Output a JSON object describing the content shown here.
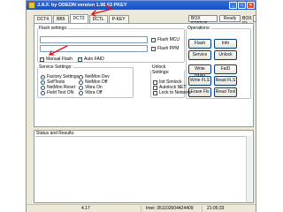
{
  "window": {
    "title": "J.A.F. by ODEON version 1.98.63 PKEY"
  },
  "tabs": [
    "DCT4",
    "BB5",
    "DCT3",
    "DCTL",
    "P-KEY"
  ],
  "header": {
    "box_status": "BOX STATUS",
    "ready": "Ready",
    "box_id_label": "BOX ID:"
  },
  "flash_settings": {
    "legend": "Flash settings:",
    "flash_mcu": "Flash MCU",
    "flash_ppm": "Flash PPM",
    "manual_flash": "Manual Flash",
    "auto_faid": "Auto FAID"
  },
  "operations": {
    "legend": "Operations:",
    "buttons": [
      "Flash",
      "Info",
      "Service",
      "Unlock",
      "Write PMM",
      "FaID",
      "Write FLS",
      "Read FLS",
      "Erase Fls",
      "Read Tool"
    ]
  },
  "service_settings": {
    "legend": "Service Settings:",
    "options": [
      "Factory Settings",
      "SelfTests",
      "NetMon Reset",
      "Field Test ON",
      "NetMon Dev",
      "NetMon Off",
      "Vibra On",
      "Vibra Off"
    ]
  },
  "unlock_settings": {
    "legend": "Unlock Settings:",
    "options": [
      "Init Simlock",
      "Autolock NET",
      "Lock to Network"
    ]
  },
  "status": {
    "label": "Status and Results:"
  },
  "statusbar": {
    "version": "4.17",
    "imei": "Imei: 351102604424409",
    "time": "21:05:33"
  },
  "colors": {
    "titlebar": "#1c4fbf",
    "annotation_arrow": "#e01010"
  }
}
